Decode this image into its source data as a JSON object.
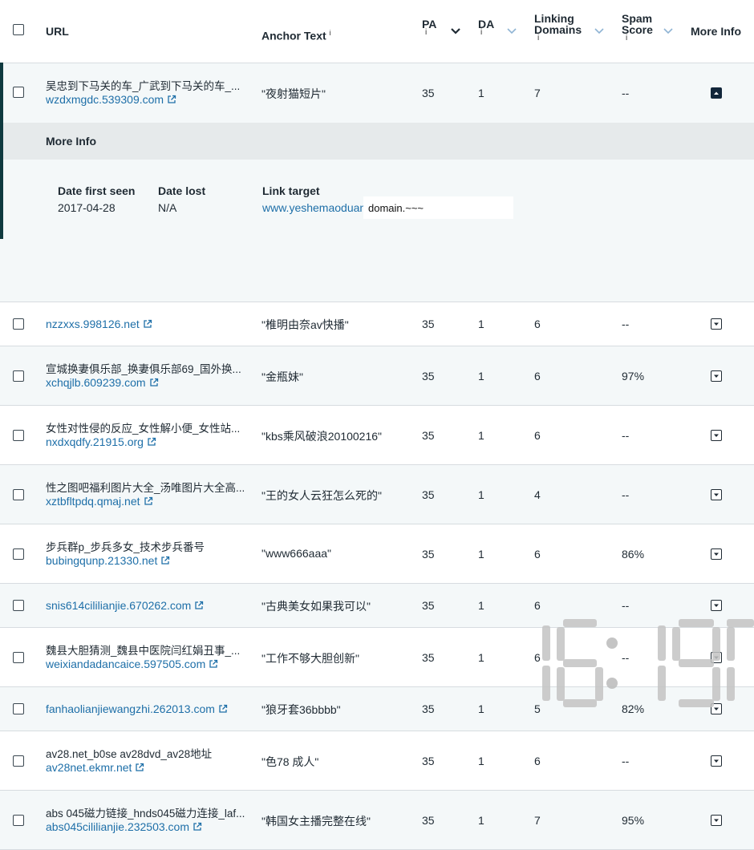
{
  "header": {
    "url": "URL",
    "anchor_text": "Anchor Text",
    "pa": "PA",
    "da": "DA",
    "linking_domains_1": "Linking",
    "linking_domains_2": "Domains",
    "spam_1": "Spam",
    "spam_2": "Score",
    "more_info": "More Info",
    "info_glyph": "i"
  },
  "expanded_row": {
    "title": "吴忠到下马关的车_广武到下马关的车_...",
    "url": "wzdxmgdc.539309.com",
    "anchor": "\"夜射猫短片\"",
    "pa": "35",
    "da": "1",
    "linking": "7",
    "spam": "--"
  },
  "more_info": {
    "heading": "More Info",
    "date_first_seen_label": "Date first seen",
    "date_first_seen": "2017-04-28",
    "date_lost_label": "Date lost",
    "date_lost": "N/A",
    "link_target_label": "Link target",
    "link_target": "www.yeshemaoduan",
    "tooltip": "domain.~~~"
  },
  "rows": [
    {
      "title": "",
      "url": "nzzxxs.998126.net",
      "anchor": "\"椎明由奈av快播\"",
      "pa": "35",
      "da": "1",
      "linking": "6",
      "spam": "--"
    },
    {
      "title": "宣城换妻俱乐部_换妻俱乐部69_国外换...",
      "url": "xchqjlb.609239.com",
      "anchor": "\"金瓶妹\"",
      "pa": "35",
      "da": "1",
      "linking": "6",
      "spam": "97%"
    },
    {
      "title": "女性对性侵的反应_女性解小便_女性站...",
      "url": "nxdxqdfy.21915.org",
      "anchor": "\"kbs乘风破浪20100216\"",
      "pa": "35",
      "da": "1",
      "linking": "6",
      "spam": "--"
    },
    {
      "title": "性之图吧福利图片大全_汤唯图片大全高...",
      "url": "xztbfltpdq.qmaj.net",
      "anchor": "\"王的女人云狂怎么死的\"",
      "pa": "35",
      "da": "1",
      "linking": "4",
      "spam": "--"
    },
    {
      "title": "步兵群p_步兵多女_技术步兵番号",
      "url": "bubingqunp.21330.net",
      "anchor": "\"www666aaa\"",
      "pa": "35",
      "da": "1",
      "linking": "6",
      "spam": "86%"
    },
    {
      "title": "",
      "url": "snis614cililianjie.670262.com",
      "anchor": "\"古典美女如果我可以\"",
      "pa": "35",
      "da": "1",
      "linking": "6",
      "spam": "--"
    },
    {
      "title": "魏县大胆猜测_魏县中医院闫红娟丑事_...",
      "url": "weixiandadancaice.597505.com",
      "anchor": "\"工作不够大胆创新\"",
      "pa": "35",
      "da": "1",
      "linking": "6",
      "spam": "--"
    },
    {
      "title": "",
      "url": "fanhaolianjiewangzhi.262013.com",
      "anchor": "\"狼牙套36bbbb\"",
      "pa": "35",
      "da": "1",
      "linking": "5",
      "spam": "82%"
    },
    {
      "title": "av28.net_b0se av28dvd_av28地址",
      "url": "av28net.ekmr.net",
      "anchor": "\"色78 成人\"",
      "pa": "35",
      "da": "1",
      "linking": "6",
      "spam": "--"
    },
    {
      "title": "abs 045磁力链接_hnds045磁力连接_laf...",
      "url": "abs045cililianjie.232503.com",
      "anchor": "\"韩国女主播完整在线\"",
      "pa": "35",
      "da": "1",
      "linking": "7",
      "spam": "95%"
    }
  ],
  "colors": {
    "link": "#1e6fa8",
    "accent": "#0f3a3f",
    "expanded_button": "#12263a"
  }
}
